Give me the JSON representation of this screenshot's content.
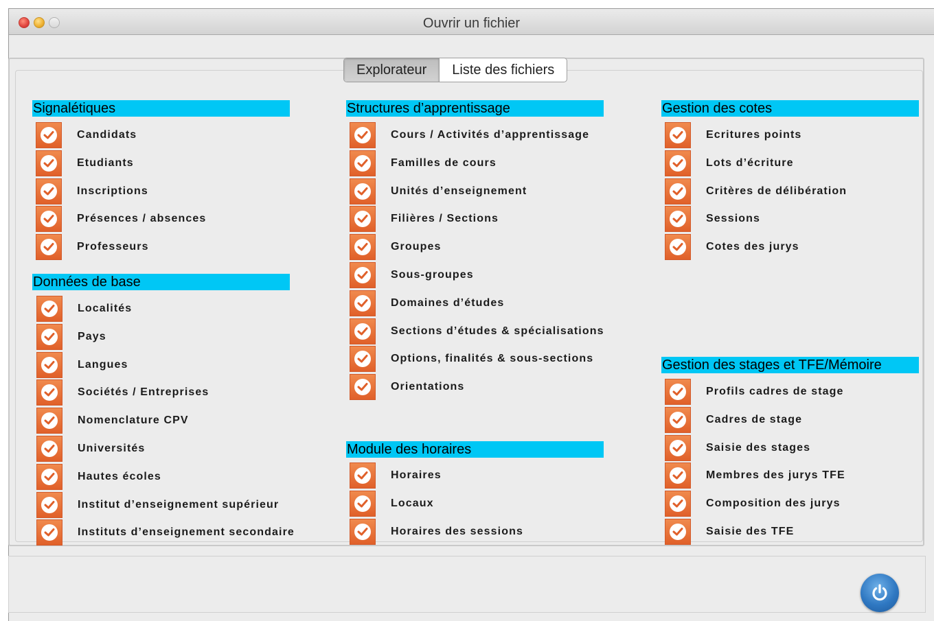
{
  "window": {
    "title": "Ouvrir un fichier"
  },
  "tabs": [
    {
      "label": "Explorateur",
      "active": true
    },
    {
      "label": "Liste des fichiers",
      "active": false
    }
  ],
  "colors": {
    "section_header": "#00c7f5",
    "check_icon": "#e8682f",
    "power_button": "#2f78c2"
  },
  "sections": {
    "signaletiques": {
      "title": "Signalétiques",
      "items": [
        "Candidats",
        "Etudiants",
        "Inscriptions",
        "Présences / absences",
        "Professeurs"
      ]
    },
    "donnees": {
      "title": "Données de base",
      "items": [
        "Localités",
        "Pays",
        "Langues",
        "Sociétés / Entreprises",
        "Nomenclature CPV",
        "Universités",
        "Hautes écoles",
        "Institut d’enseignement supérieur",
        "Instituts d’enseignement secondaire"
      ]
    },
    "structures": {
      "title": "Structures d’apprentissage",
      "items": [
        "Cours / Activités d’apprentissage",
        "Familles de cours",
        "Unités d’enseignement",
        "Filières / Sections",
        "Groupes",
        "Sous-groupes",
        "Domaines d’études",
        "Sections d’études & spécialisations",
        "Options, finalités & sous-sections",
        "Orientations"
      ]
    },
    "horaires": {
      "title": "Module des horaires",
      "items": [
        "Horaires",
        "Locaux",
        "Horaires des sessions"
      ]
    },
    "cotes": {
      "title": "Gestion des cotes",
      "items": [
        "Ecritures points",
        "Lots d’écriture",
        "Critères de délibération",
        "Sessions",
        "Cotes des jurys"
      ]
    },
    "stages": {
      "title": "Gestion des stages et TFE/Mémoire",
      "items": [
        "Profils cadres de stage",
        "Cadres de stage",
        "Saisie des stages",
        "Membres des jurys TFE",
        "Composition des jurys",
        "Saisie des TFE"
      ]
    }
  },
  "footer": {
    "power_icon": "power-icon"
  }
}
